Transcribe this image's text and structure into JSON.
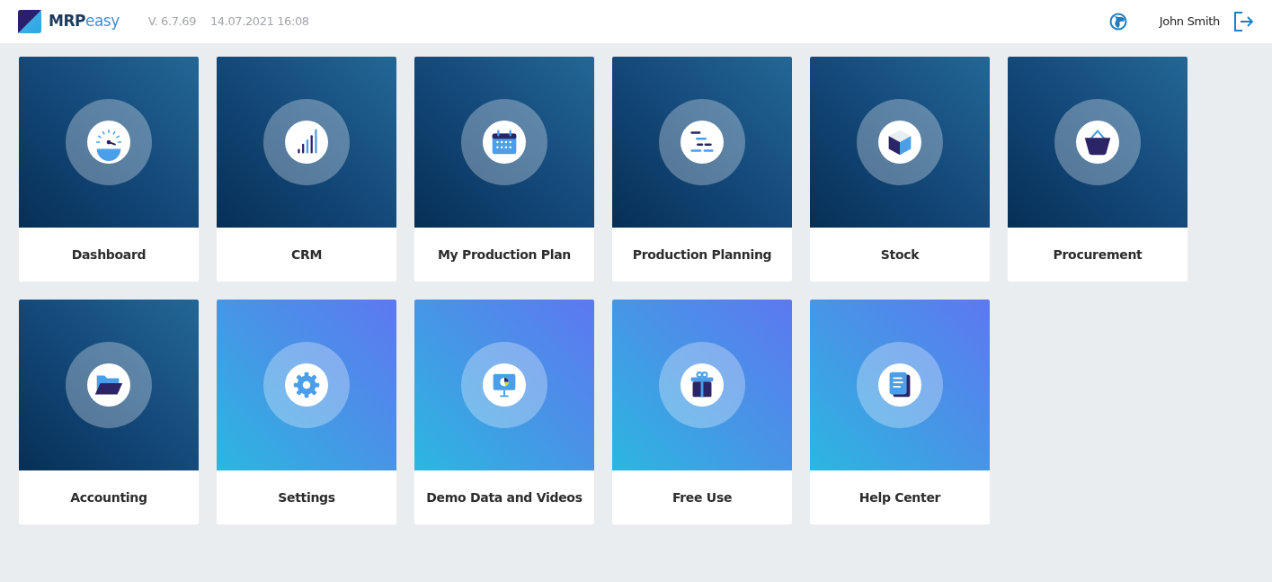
{
  "header": {
    "brand": {
      "bold": "MRP",
      "light": "easy"
    },
    "version": "V. 6.7.69",
    "datetime": "14.07.2021 16:08",
    "user": "John Smith"
  },
  "tiles": [
    {
      "label": "Dashboard",
      "kind": "module"
    },
    {
      "label": "CRM",
      "kind": "module"
    },
    {
      "label": "My Production Plan",
      "kind": "module"
    },
    {
      "label": "Production Planning",
      "kind": "module"
    },
    {
      "label": "Stock",
      "kind": "module"
    },
    {
      "label": "Procurement",
      "kind": "module"
    },
    {
      "label": "Accounting",
      "kind": "module"
    },
    {
      "label": "Settings",
      "kind": "resource"
    },
    {
      "label": "Demo Data and Videos",
      "kind": "resource"
    },
    {
      "label": "Free Use",
      "kind": "resource"
    },
    {
      "label": "Help Center",
      "kind": "resource"
    }
  ]
}
